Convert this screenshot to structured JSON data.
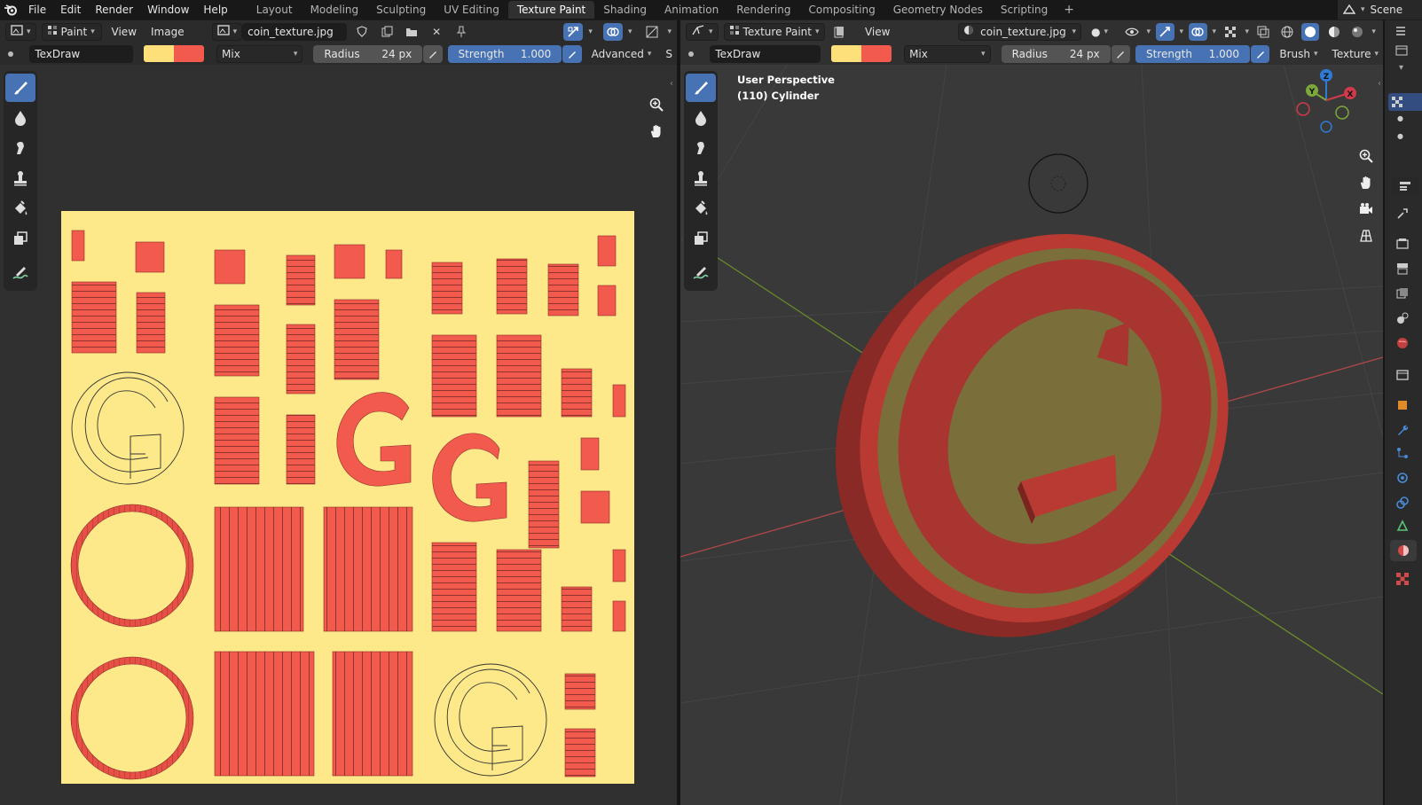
{
  "top_menu": {
    "items": [
      "File",
      "Edit",
      "Render",
      "Window",
      "Help"
    ],
    "workspaces": [
      "Layout",
      "Modeling",
      "Sculpting",
      "UV Editing",
      "Texture Paint",
      "Shading",
      "Animation",
      "Rendering",
      "Compositing",
      "Geometry Nodes",
      "Scripting"
    ],
    "active_workspace": "Texture Paint",
    "add_workspace": "+",
    "scene": "Scene"
  },
  "image_editor": {
    "mode": "Paint",
    "menu_view": "View",
    "menu_image": "Image",
    "image_name": "coin_texture.jpg",
    "brush_name": "TexDraw",
    "blend": "Mix",
    "radius_label": "Radius",
    "radius_value": "24 px",
    "strength_label": "Strength",
    "strength_value": "1.000",
    "advanced": "Advanced",
    "cut_label": "S"
  },
  "viewport": {
    "mode": "Texture Paint",
    "menu_view": "View",
    "image_name": "coin_texture.jpg",
    "brush_name": "TexDraw",
    "blend": "Mix",
    "radius_label": "Radius",
    "radius_value": "24 px",
    "strength_label": "Strength",
    "strength_value": "1.000",
    "brush_menu": "Brush",
    "texture_menu": "Texture",
    "info_line1": "User Perspective",
    "info_line2": "(110) Cylinder",
    "gizmo_z": "Z",
    "gizmo_y": "Y",
    "gizmo_x": "X"
  },
  "colors": {
    "primary": "#fde07a",
    "secondary": "#f25a4e",
    "accent": "#4772b3",
    "texture_bg": "#fde98a",
    "texture_red": "#f25a4e",
    "coin_red": "#b83a32",
    "coin_yellow": "#7a6e3a"
  },
  "icons": {
    "tools": [
      "brush-draw-icon",
      "brush-soften-icon",
      "brush-smear-icon",
      "brush-clone-icon",
      "brush-fill-icon",
      "brush-mask-icon",
      "annotate-icon"
    ]
  }
}
